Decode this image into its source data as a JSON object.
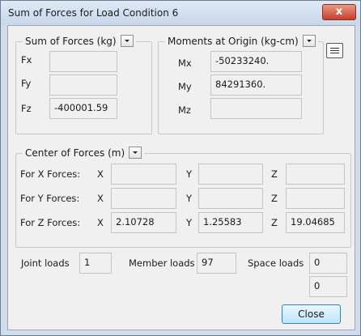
{
  "window": {
    "title": "Sum of Forces for Load Condition 6",
    "close_glyph": "x"
  },
  "sum_forces": {
    "label": "Sum of Forces (kg)",
    "rows": [
      {
        "name": "Fx",
        "value": ""
      },
      {
        "name": "Fy",
        "value": ""
      },
      {
        "name": "Fz",
        "value": "-400001.59"
      }
    ]
  },
  "moments": {
    "label": "Moments at Origin (kg-cm)",
    "rows": [
      {
        "name": "Mx",
        "value": "-50233240."
      },
      {
        "name": "My",
        "value": "84291360."
      },
      {
        "name": "Mz",
        "value": ""
      }
    ]
  },
  "center": {
    "label": "Center of Forces (m)",
    "rows": [
      {
        "label": "For X Forces:",
        "x_label": "X",
        "x": "",
        "y_label": "Y",
        "y": "",
        "z_label": "Z",
        "z": ""
      },
      {
        "label": "For Y Forces:",
        "x_label": "X",
        "x": "",
        "y_label": "Y",
        "y": "",
        "z_label": "Z",
        "z": ""
      },
      {
        "label": "For Z Forces:",
        "x_label": "X",
        "x": "2.10728",
        "y_label": "Y",
        "y": "1.25583",
        "z_label": "Z",
        "z": "19.04685"
      }
    ]
  },
  "loads": {
    "joint_label": "Joint loads",
    "joint_value": "1",
    "member_label": "Member loads",
    "member_value": "97",
    "space_label": "Space loads",
    "space_value": "0",
    "extra_value": "0"
  },
  "buttons": {
    "close": "Close"
  },
  "icons": {
    "dropdown": "chevron-down-icon",
    "menu": "menu-icon"
  }
}
